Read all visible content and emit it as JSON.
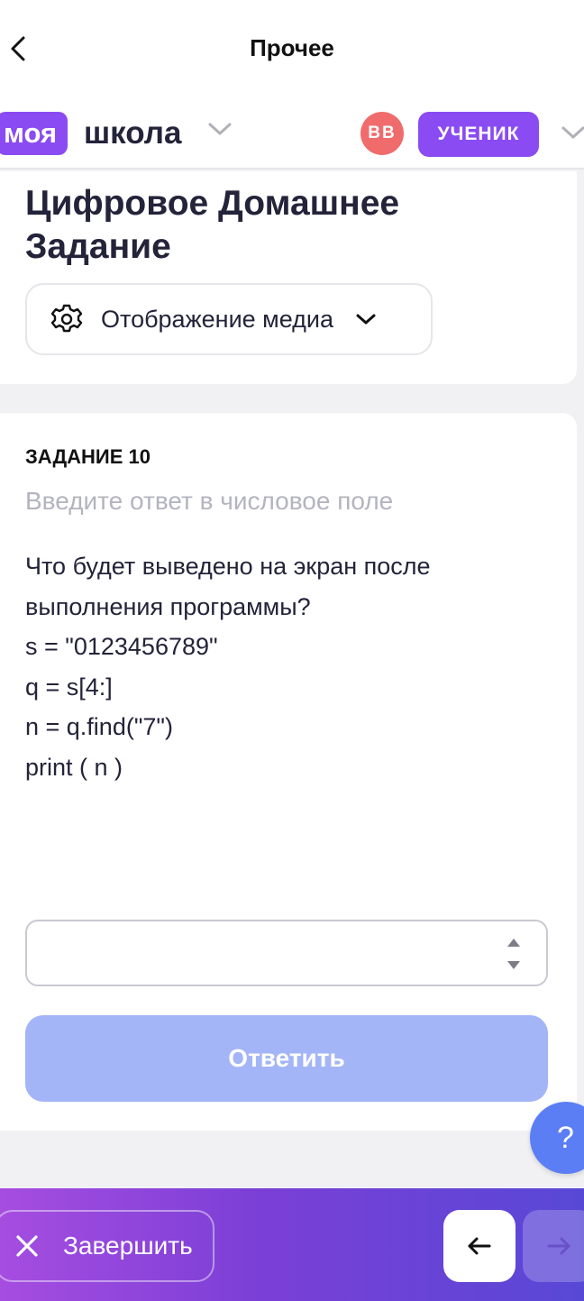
{
  "nav": {
    "title": "Прочее"
  },
  "header": {
    "logo_badge": "моя",
    "logo_text": "школа",
    "avatar_initials": "ВВ",
    "role": "УЧЕНИК"
  },
  "page": {
    "title": "Цифровое Домашнее Задание",
    "media_button_label": "Отображение медиа"
  },
  "task": {
    "label": "ЗАДАНИЕ 10",
    "hint": "Введите ответ в числовое поле",
    "question_lines": [
      "Что будет выведено на экран после",
      "выполнения программы?",
      "s = \"0123456789\"",
      "q = s[4:]",
      "n = q.find(\"7\")",
      "print ( n )"
    ],
    "answer_value": "",
    "submit_label": "Ответить"
  },
  "help": {
    "label": "?"
  },
  "footer": {
    "finish_label": "Завершить"
  },
  "colors": {
    "accent": "#8a4bf2",
    "avatar": "#f06c6c",
    "submit_disabled": "#a4b5f7",
    "help": "#5b7ef5"
  },
  "icons": [
    "back-icon",
    "chevron-down-icon",
    "gear-icon",
    "stepper-icon",
    "close-icon",
    "arrow-left-icon",
    "arrow-right-icon"
  ]
}
